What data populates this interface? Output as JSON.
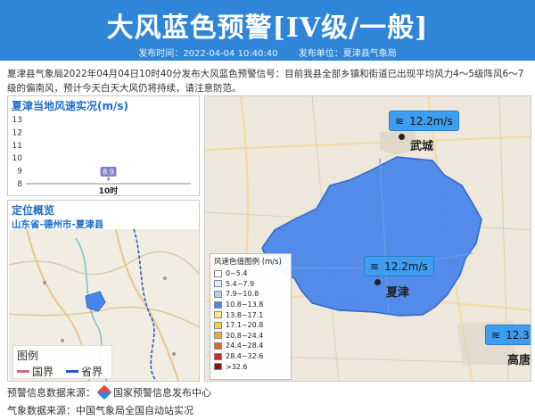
{
  "header": {
    "title": "大风蓝色预警[IV级/一般]",
    "publish_time_label": "发布时间：2022-04-04 10:40:40",
    "publisher_label": "发布单位：夏津县气象局",
    "background_color": "#2f86d8"
  },
  "intro_text": "夏津县气象局2022年04月04日10时40分发布大风蓝色预警信号：目前我县全部乡镇和街道已出现平均风力4～5级阵风6～7级的偏南风，预计今天白天大风仍将持续，请注意防范。",
  "wind_panel": {
    "title": "夏津当地风速实况(m/s)"
  },
  "chart_data": {
    "type": "scatter",
    "title": "夏津当地风速实况(m/s)",
    "categories": [
      "10时"
    ],
    "y_ticks": [
      8,
      9,
      10,
      11,
      12,
      13
    ],
    "ylim": [
      8,
      13
    ],
    "series": [
      {
        "values": [
          8.9
        ],
        "labels": [
          "8.9"
        ]
      }
    ],
    "point_color": "#7f83c4",
    "grid": false
  },
  "location_panel": {
    "title": "定位概览",
    "region": "山东省-德州市-夏津县",
    "legend_title": "图例",
    "legend_items": [
      {
        "label": "国界",
        "color": "#c9706f"
      },
      {
        "label": "省界",
        "color": "#2f57c9"
      }
    ]
  },
  "map": {
    "tags": [
      {
        "speed": "12.2m/s",
        "icon": "wind-icon"
      },
      {
        "speed": "12.2m/s",
        "icon": "wind-icon"
      },
      {
        "speed": "12.3",
        "icon": "wind-icon"
      }
    ],
    "cities": [
      "武城",
      "夏津",
      "高唐"
    ],
    "warning_area_color": "#4a86ea"
  },
  "speed_legend": {
    "title": "风速色值图例 (m/s)",
    "rows": [
      {
        "label": "0~5.4",
        "color": "#ffffff"
      },
      {
        "label": "5.4~7.9",
        "color": "#dcecfb"
      },
      {
        "label": "7.9~10.8",
        "color": "#a9d0f6"
      },
      {
        "label": "10.8~13.8",
        "color": "#4a86ea"
      },
      {
        "label": "13.8~17.1",
        "color": "#ffe98a"
      },
      {
        "label": "17.1~20.8",
        "color": "#f6d23c"
      },
      {
        "label": "20.8~24.4",
        "color": "#f5a33a"
      },
      {
        "label": "24.4~28.4",
        "color": "#e8671f"
      },
      {
        "label": "28.4~32.6",
        "color": "#cc2a1f"
      },
      {
        "label": ">32.6",
        "color": "#8e1111"
      }
    ]
  },
  "footer": {
    "warning_source": "预警信息数据来源：",
    "warning_source_name": "国家预警信息发布中心",
    "weather_source": "气象数据来源：中国气象局全国自动站实况"
  }
}
